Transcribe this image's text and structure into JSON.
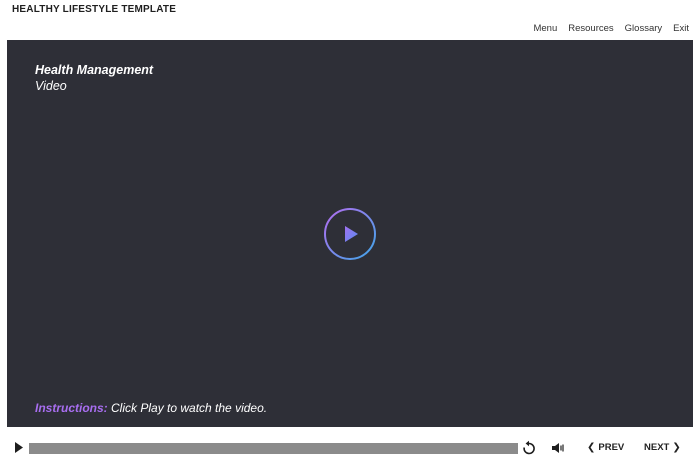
{
  "header": {
    "course_title": "HEALTHY LIFESTYLE TEMPLATE",
    "nav": [
      "Menu",
      "Resources",
      "Glossary",
      "Exit"
    ]
  },
  "slide": {
    "title": "Health Management",
    "subtitle": "Video",
    "instructions_label": "Instructions:",
    "instructions_text": "Click Play to watch the video.",
    "background_color": "#2e2f37",
    "accent_color": "#a86ef0"
  },
  "player": {
    "play_icon": "play-icon",
    "progress": 0.0,
    "replay_icon": "replay-icon",
    "volume_icon": "volume-icon",
    "prev_label": "PREV",
    "next_label": "NEXT"
  }
}
